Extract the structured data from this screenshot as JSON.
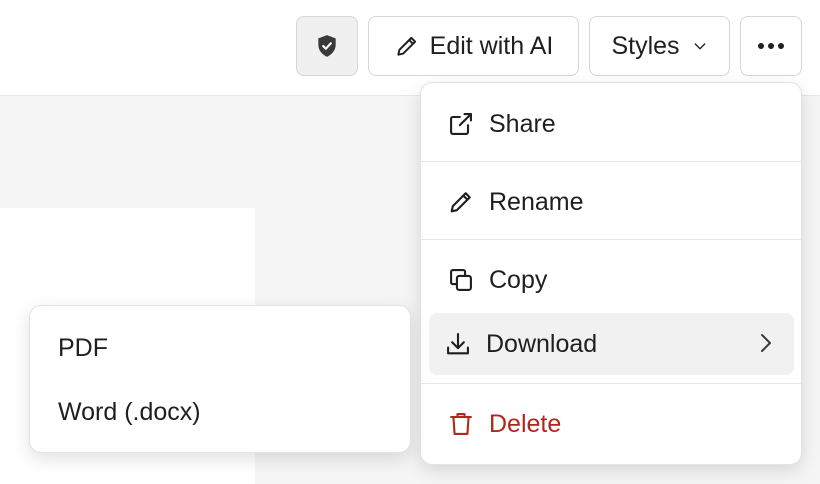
{
  "toolbar": {
    "edit_ai_label": "Edit with AI",
    "styles_label": "Styles"
  },
  "menu": {
    "items": [
      {
        "label": "Share",
        "icon": "share-icon"
      },
      {
        "label": "Rename",
        "icon": "pencil-icon"
      },
      {
        "label": "Copy",
        "icon": "copy-icon"
      },
      {
        "label": "Download",
        "icon": "download-icon"
      },
      {
        "label": "Delete",
        "icon": "trash-icon"
      }
    ]
  },
  "submenu": {
    "items": [
      {
        "label": "PDF"
      },
      {
        "label": "Word (.docx)"
      }
    ]
  },
  "colors": {
    "danger": "#b3261e",
    "active_bg": "#f1f1f1"
  }
}
